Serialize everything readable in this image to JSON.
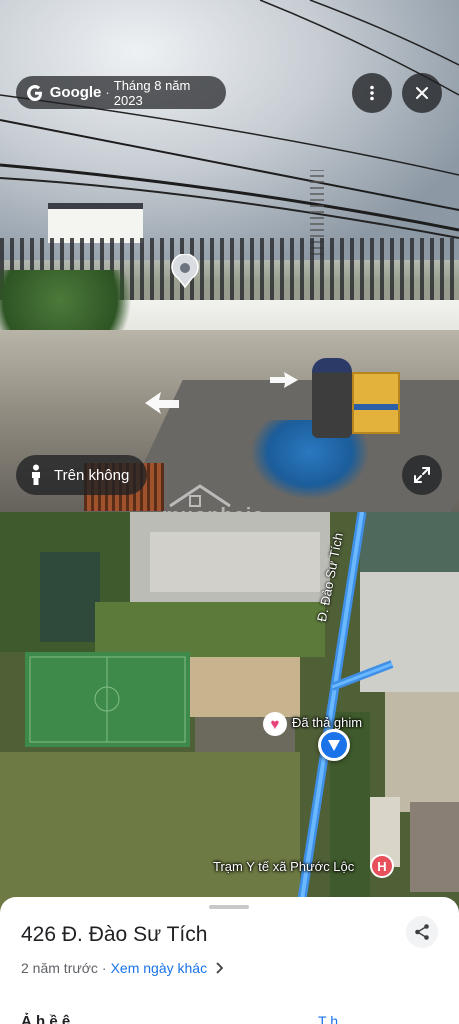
{
  "street_view": {
    "brand": "Google",
    "separator": "·",
    "capture_date": "Tháng 8 năm 2023",
    "overview_label": "Trên không"
  },
  "map": {
    "watermark": "muonhaja",
    "road_name": "Đ. Đào Sư Tích",
    "saved_pin_label": "Đã thả ghim",
    "poi_label": "Trạm Y tế xã Phước Lộc"
  },
  "sheet": {
    "address": "426 Đ. Đào Sư Tích",
    "age": "2 năm trước",
    "meta_separator": "·",
    "other_dates_link": "Xem ngày khác",
    "peek_left": "Ả   h  ề  ê",
    "peek_right": "T   h"
  },
  "colors": {
    "accent": "#1a73e8",
    "pin": "#e8437a",
    "hospital": "#e8505b",
    "road": "#4ea8ff"
  }
}
